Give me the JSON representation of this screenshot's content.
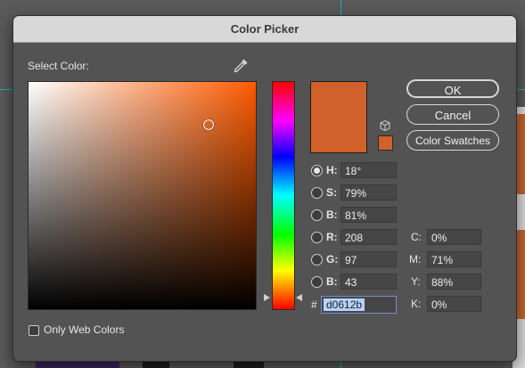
{
  "window": {
    "title": "Color Picker"
  },
  "picker": {
    "select_label": "Select Color:",
    "current_color": "#d0612b",
    "marker_hue_color": "#ff5a00"
  },
  "buttons": {
    "ok": "OK",
    "cancel": "Cancel",
    "swatches": "Color Swatches"
  },
  "hsb": [
    {
      "label": "H:",
      "value": "18°",
      "selected": true
    },
    {
      "label": "S:",
      "value": "79%",
      "selected": false
    },
    {
      "label": "B:",
      "value": "81%",
      "selected": false
    }
  ],
  "rgb": [
    {
      "label": "R:",
      "value": "208"
    },
    {
      "label": "G:",
      "value": "97"
    },
    {
      "label": "B:",
      "value": "43"
    }
  ],
  "cmyk": [
    {
      "label": "C:",
      "value": "0%"
    },
    {
      "label": "M:",
      "value": "71%"
    },
    {
      "label": "Y:",
      "value": "88%"
    },
    {
      "label": "K:",
      "value": "0%"
    }
  ],
  "hex": {
    "prefix": "#",
    "value": "d0612b"
  },
  "web_colors": {
    "label": "Only Web Colors",
    "checked": false
  },
  "icons": [
    "eyedropper-icon",
    "cube-icon"
  ]
}
